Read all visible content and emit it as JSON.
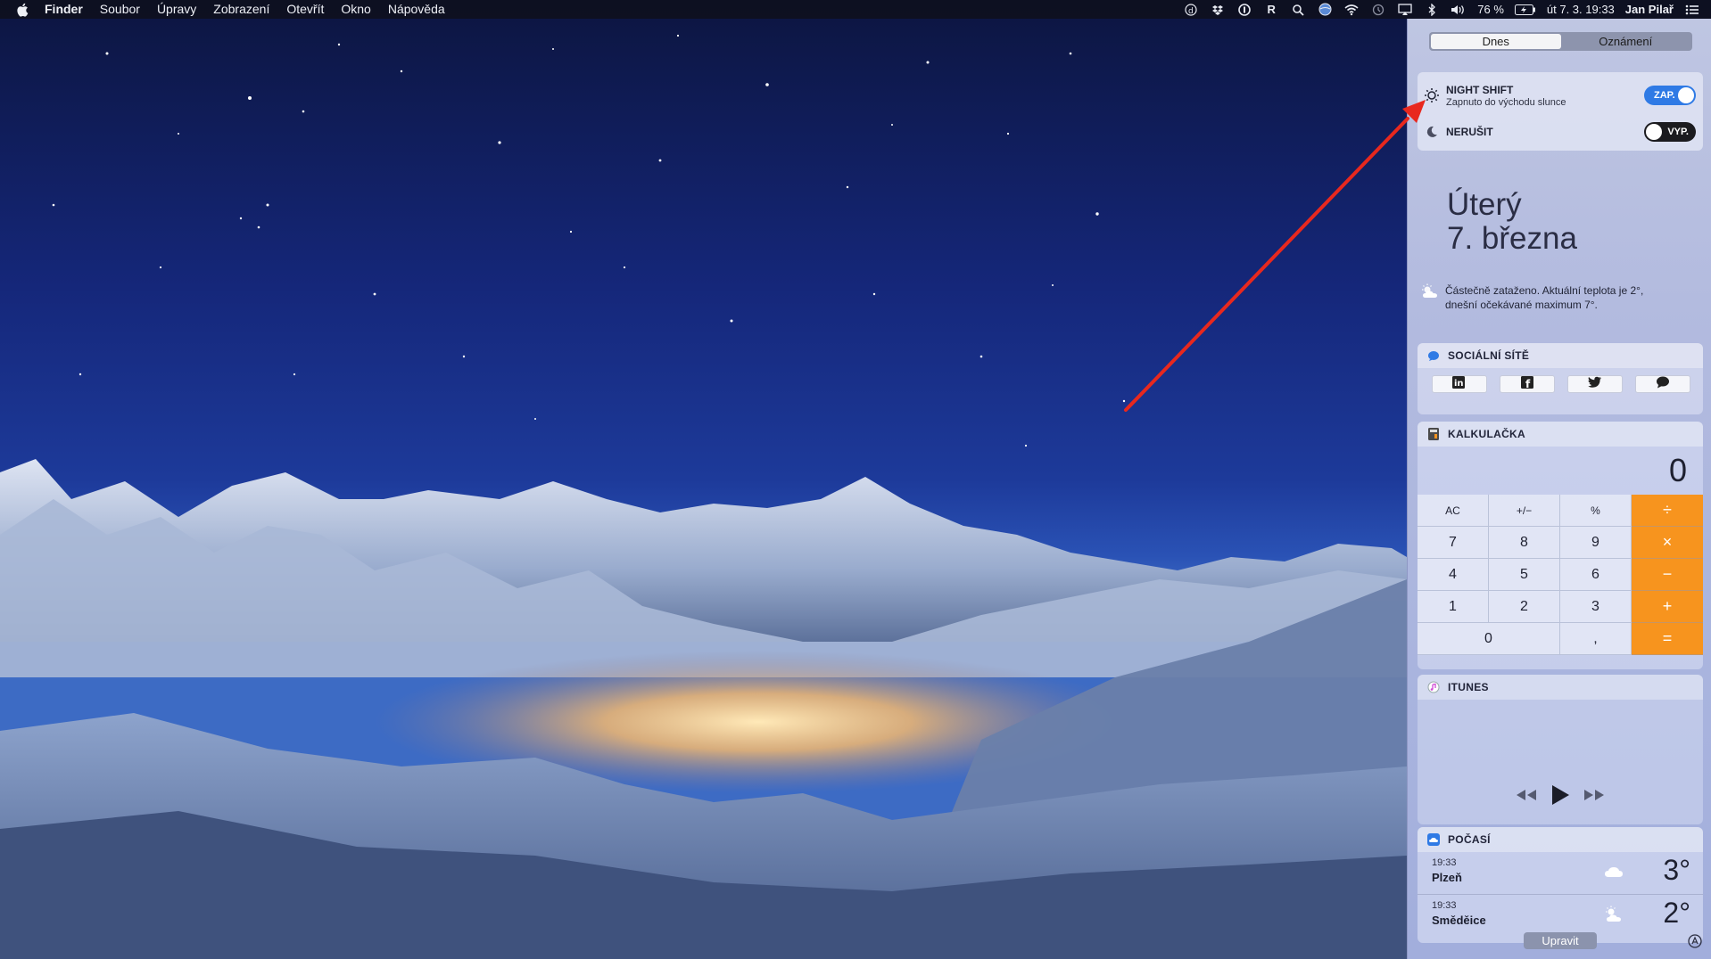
{
  "menubar": {
    "app_name": "Finder",
    "menus": [
      "Soubor",
      "Úpravy",
      "Zobrazení",
      "Otevřít",
      "Okno",
      "Nápověda"
    ],
    "status_icons": [
      "dictation-icon",
      "dropbox-icon",
      "onepassword-icon",
      "r-icon",
      "search-icon",
      "globe-icon",
      "wifi-icon",
      "time-machine-icon",
      "airplay-icon",
      "bluetooth-icon",
      "volume-icon"
    ],
    "battery": "76 %",
    "datetime": "út 7. 3.  19:33",
    "user": "Jan Pilař"
  },
  "notification_center": {
    "tabs": [
      "Dnes",
      "Oznámení"
    ],
    "active_tab": "Dnes",
    "night_shift": {
      "title": "NIGHT SHIFT",
      "subtitle": "Zapnuto do východu slunce",
      "toggle": "ZAP."
    },
    "do_not_disturb": {
      "title": "NERUŠIT",
      "toggle": "VYP."
    },
    "date": {
      "weekday": "Úterý",
      "day": "7. března"
    },
    "weather_summary_line1": "Částečně zataženo. Aktuální teplota je 2°,",
    "weather_summary_line2": "dnešní očekávané maximum 7°.",
    "social": {
      "title": "SOCIÁLNÍ SÍTĚ",
      "buttons": [
        "linkedin-icon",
        "facebook-icon",
        "twitter-icon",
        "messages-icon"
      ]
    },
    "calculator": {
      "title": "KALKULAČKA",
      "display": "0",
      "keys": [
        [
          "AC",
          "+/−",
          "%",
          "÷"
        ],
        [
          "7",
          "8",
          "9",
          "×"
        ],
        [
          "4",
          "5",
          "6",
          "−"
        ],
        [
          "1",
          "2",
          "3",
          "+"
        ],
        [
          "0",
          ",",
          "="
        ]
      ]
    },
    "itunes": {
      "title": "ITUNES"
    },
    "weather": {
      "title": "POČASÍ",
      "rows": [
        {
          "time": "19:33",
          "city": "Plzeň",
          "temp": "3°",
          "icon": "cloud-icon"
        },
        {
          "time": "19:33",
          "city": "Směděice",
          "temp": "2°",
          "icon": "partly-cloudy-night-icon"
        }
      ]
    },
    "edit_label": "Upravit"
  },
  "colors": {
    "accent_toggle": "#2f7ae5",
    "calc_operator": "#f7941e",
    "annotation_arrow": "#e8281e"
  }
}
